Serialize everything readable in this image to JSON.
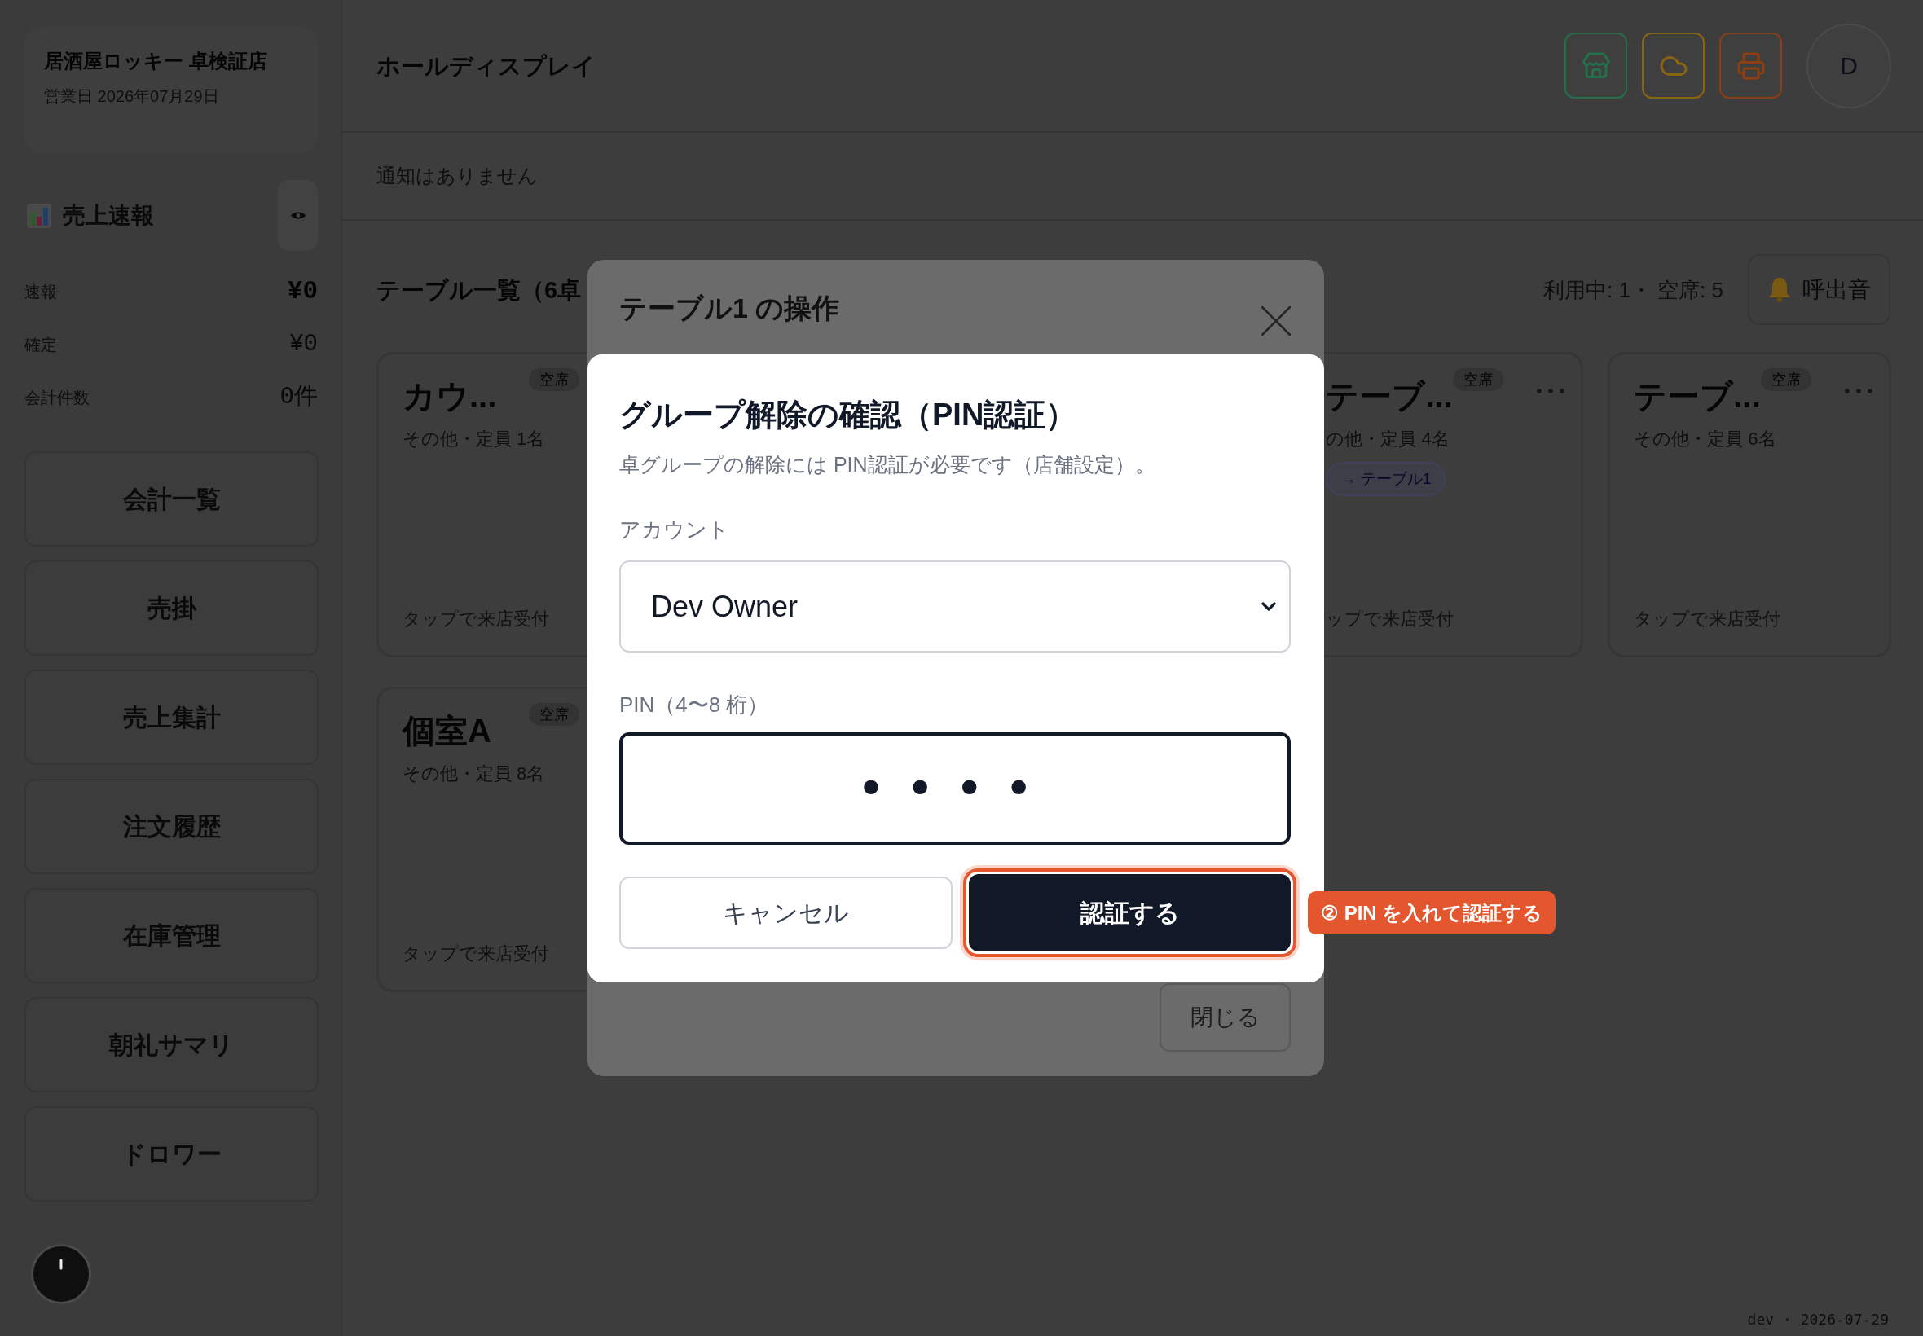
{
  "sidebar": {
    "store": {
      "name": "居酒屋ロッキー 卓検証店",
      "business_date": "営業日 2026年07月29日"
    },
    "sales": {
      "title": "売上速報",
      "rows": [
        {
          "label": "速報",
          "value": "¥0"
        },
        {
          "label": "確定",
          "value": "¥0"
        },
        {
          "label": "会計件数",
          "value": "0件"
        }
      ]
    },
    "nav": [
      "会計一覧",
      "売掛",
      "売上集計",
      "注文履歴",
      "在庫管理",
      "朝礼サマリ",
      "ドロワー"
    ]
  },
  "header": {
    "title": "ホールディスプレイ",
    "status_icons": [
      {
        "kind": "store",
        "color": "#23704a"
      },
      {
        "kind": "cloud",
        "color": "#8a6410"
      },
      {
        "kind": "printer",
        "color": "#8c3f12"
      }
    ],
    "avatar": "D"
  },
  "notification": "通知はありません",
  "tables": {
    "title": "テーブル一覧（6卓",
    "summary": "利用中: 1・ 空席: 5",
    "chime_button": "呼出音",
    "cards": [
      {
        "name": "カウ...",
        "status": "空席",
        "info": "その他・定員 1名",
        "hint": "タップで来店受付",
        "menu": false
      },
      {
        "name": "テーブ...",
        "status": "空席",
        "info": "の他・定員 4名",
        "group": "→ テーブル1",
        "hint": "ップで来店受付",
        "menu": true
      },
      {
        "name": "テーブ...",
        "status": "空席",
        "info": "その他・定員 6名",
        "hint": "タップで来店受付",
        "menu": true
      },
      {
        "name": "個室A",
        "status": "空席",
        "info": "その他・定員 8名",
        "hint": "タップで来店受付",
        "menu": false
      }
    ]
  },
  "table_dialog": {
    "title": "テーブル1 の操作",
    "close_button": "閉じる"
  },
  "pin_dialog": {
    "title": "グループ解除の確認（PIN認証）",
    "description": "卓グループの解除には PIN認証が必要です（店舗設定）。",
    "account_label": "アカウント",
    "account": "Dev Owner",
    "pin_label": "PIN（4〜8 桁）",
    "pin_value": "••••",
    "cancel": "キャンセル",
    "confirm": "認証する"
  },
  "callout": "② PIN を入れて認証する",
  "footer": "dev · 2026-07-29"
}
